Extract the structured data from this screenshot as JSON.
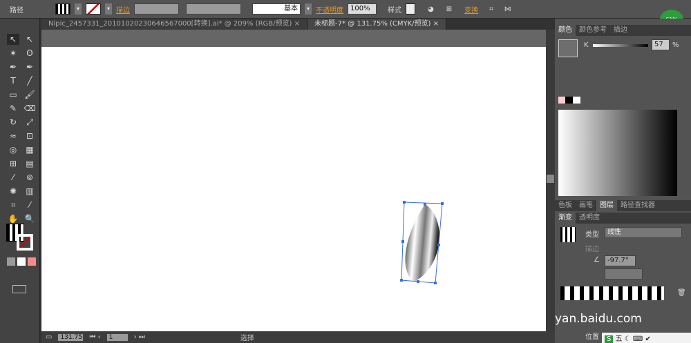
{
  "toolbar": {
    "object_type": "路径",
    "stroke_label": "描边",
    "stroke_profile": "基本",
    "opacity_label": "不透明度",
    "opacity_value": "100%",
    "style_label": "样式",
    "transform_label": "变换"
  },
  "tabs": [
    {
      "label": "Nipic_2457331_20101020230646567000[转换].ai* @ 209% (RGB/预览)",
      "active": false
    },
    {
      "label": "未标题-7* @ 131.75% (CMYK/预览)",
      "active": true
    }
  ],
  "color_panel": {
    "tabs": [
      "颜色",
      "颜色参考",
      "描边"
    ],
    "channel": "K",
    "value": "57",
    "unit": "%"
  },
  "mid_tabs": [
    "色板",
    "画笔",
    "图层",
    "路径查找器"
  ],
  "gradient_panel": {
    "tabs": [
      "渐变",
      "透明度"
    ],
    "type_label": "类型",
    "type_value": "线性",
    "stroke_label": "描边",
    "angle_value": "-97.7°",
    "position_label": "位置"
  },
  "status": {
    "zoom": "131.75",
    "artboard": "1",
    "tool": "选择"
  },
  "watermark": "yan.baidu.com",
  "badge": "61%",
  "ime": [
    "S",
    "五"
  ]
}
